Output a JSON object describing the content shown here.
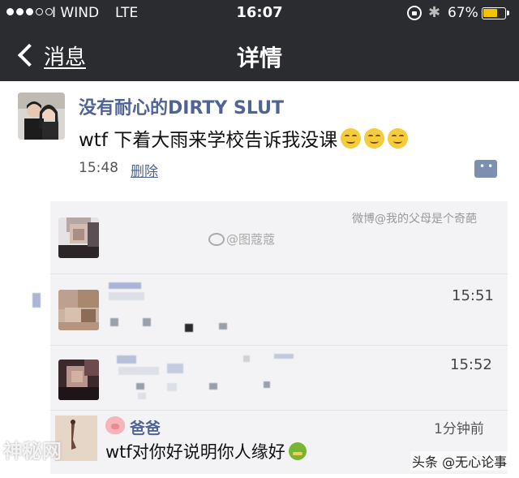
{
  "status_bar": {
    "carrier": "I WIND",
    "network": "LTE",
    "time": "16:07",
    "battery": "67%",
    "battery_level": 0.67,
    "signal_bars_filled": 3,
    "signal_bars_total": 5
  },
  "nav": {
    "back_label": "消息",
    "title": "详情"
  },
  "post": {
    "username": "没有耐心的DIRTY SLUT",
    "text": "wtf 下着大雨来学校告诉我没课",
    "emoji_count": 3,
    "time": "15:48",
    "delete_label": "删除"
  },
  "comments": [
    {
      "time": "15:51"
    },
    {
      "time": "15:52"
    }
  ],
  "reply": {
    "name": "爸爸",
    "time": "1分钟前",
    "text": "wtf对你好说明你人缘好"
  },
  "watermarks": {
    "weibo_tag": "微博@我的父母是个奇葩",
    "weibo_handle": "@图蔻蔻",
    "site_logo": "神秘网",
    "toutiao": "头条 @无心论事"
  },
  "colors": {
    "bar_bg": "#2b2c30",
    "name_blue": "#4f6395",
    "battery": "#f5c400",
    "panel_bg": "#f3f3f5"
  }
}
